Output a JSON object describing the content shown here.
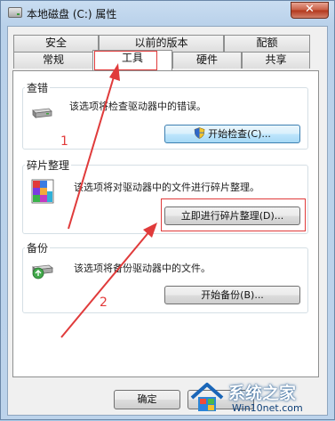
{
  "window": {
    "title": "本地磁盘 (C:) 属性",
    "close_glyph": "✕"
  },
  "tabs": {
    "row1": [
      "安全",
      "以前的版本",
      "配额"
    ],
    "row2": [
      "常规",
      "工具",
      "硬件",
      "共享"
    ],
    "active": "工具"
  },
  "error_check": {
    "title": "查错",
    "description": "该选项将检查驱动器中的错误。",
    "button": "开始检查(C)..."
  },
  "defrag": {
    "title": "碎片整理",
    "description": "该选项将对驱动器中的文件进行碎片整理。",
    "button": "立即进行碎片整理(D)..."
  },
  "backup": {
    "title": "备份",
    "description": "该选项将备份驱动器中的文件。",
    "button": "开始备份(B)..."
  },
  "footer": {
    "ok": "确定"
  },
  "annotations": {
    "marker1": "1",
    "marker2": "2",
    "color": "#e03b3b"
  },
  "watermark": {
    "brand": "系统之家",
    "url": "Win10net.com"
  }
}
